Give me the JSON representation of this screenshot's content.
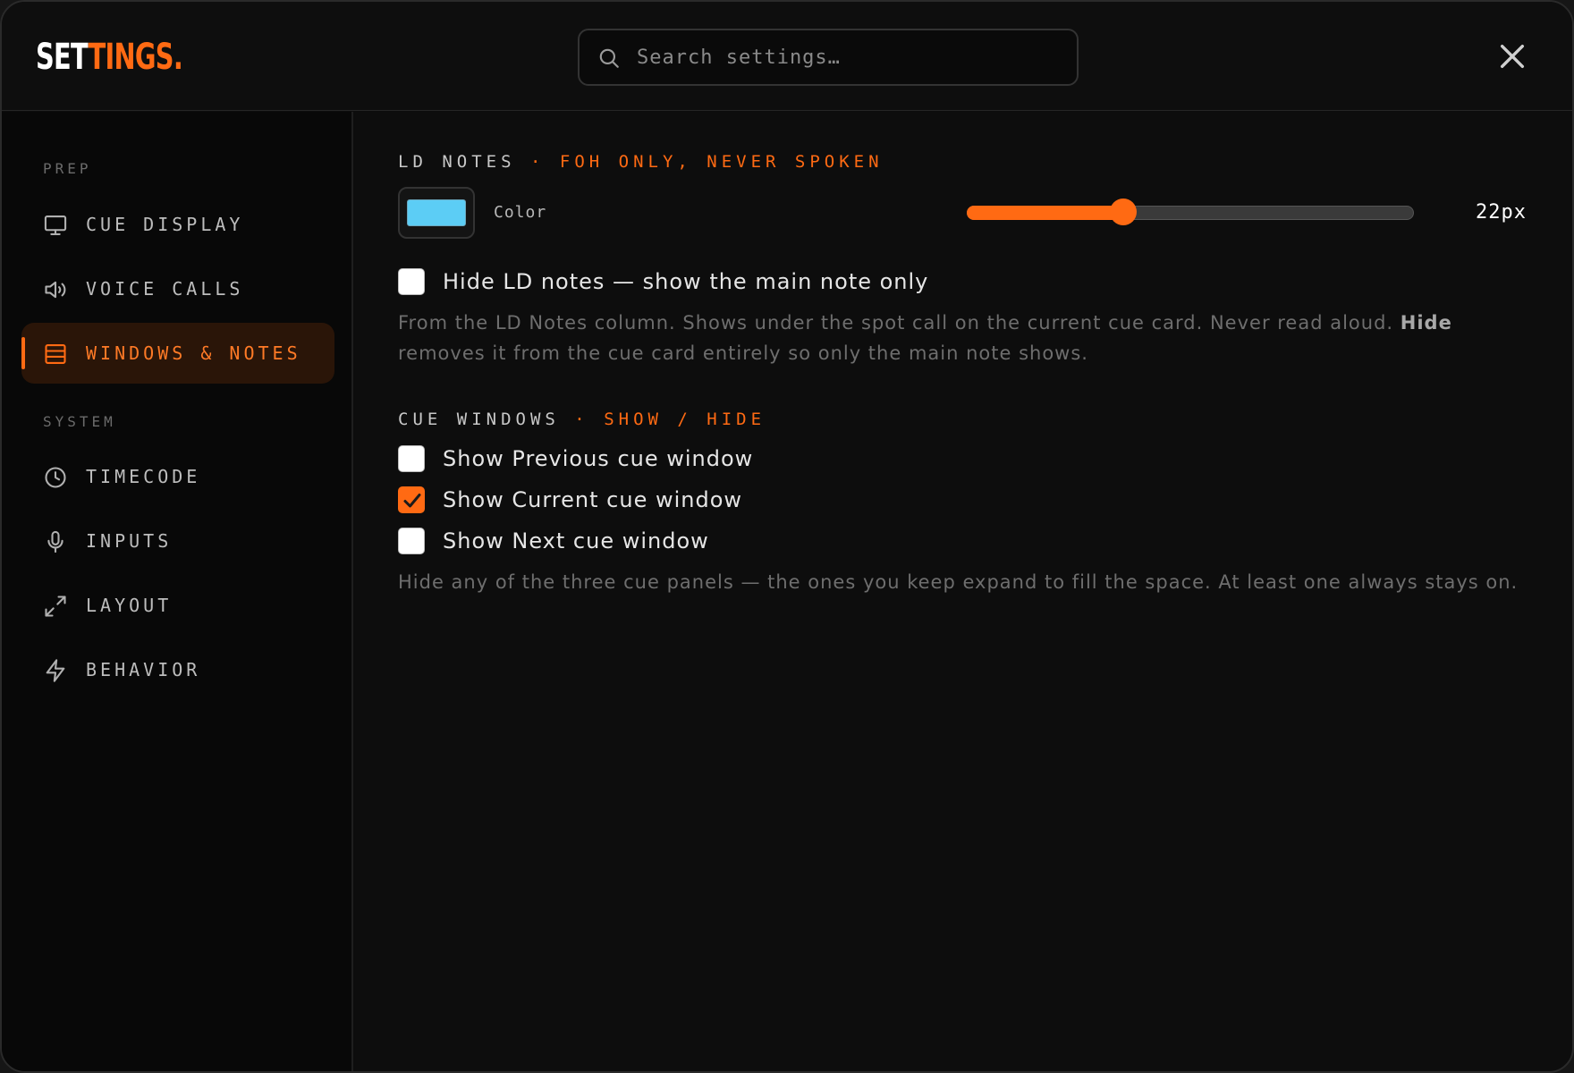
{
  "app": {
    "logo_part1": "SET",
    "logo_part2": "TINGS."
  },
  "colors": {
    "accent": "#ff6a13",
    "active_bg": "#2a1508",
    "ld_note_color": "#5ccdf5"
  },
  "search": {
    "placeholder": "Search settings…",
    "value": ""
  },
  "sidebar": {
    "sections": [
      {
        "label": "PREP",
        "items": [
          {
            "label": "CUE DISPLAY",
            "icon": "monitor-icon",
            "active": false
          },
          {
            "label": "VOICE CALLS",
            "icon": "speaker-icon",
            "active": false
          },
          {
            "label": "WINDOWS & NOTES",
            "icon": "windows-icon",
            "active": true
          }
        ]
      },
      {
        "label": "SYSTEM",
        "items": [
          {
            "label": "TIMECODE",
            "icon": "clock-icon",
            "active": false
          },
          {
            "label": "INPUTS",
            "icon": "microphone-icon",
            "active": false
          },
          {
            "label": "LAYOUT",
            "icon": "expand-icon",
            "active": false
          },
          {
            "label": "BEHAVIOR",
            "icon": "lightning-icon",
            "active": false
          }
        ]
      }
    ]
  },
  "ld_notes": {
    "heading": "LD NOTES",
    "separator": "·",
    "heading_accent": "FOH ONLY, NEVER SPOKEN",
    "color_label": "Color",
    "size_value": 22,
    "size_min": 8,
    "size_max": 48,
    "size_label": "22px",
    "hide_label": "Hide LD notes — show the main note only",
    "hide_checked": false,
    "desc_part1": "From the LD Notes column. Shows under the spot call on the current cue card. Never read aloud.",
    "desc_bold": "Hide",
    "desc_part2": "removes it from the cue card entirely so only the main note shows."
  },
  "cue_windows": {
    "heading": "CUE WINDOWS",
    "separator": "·",
    "heading_accent": "SHOW / HIDE",
    "options": [
      {
        "label": "Show Previous cue window",
        "checked": false
      },
      {
        "label": "Show Current cue window",
        "checked": true
      },
      {
        "label": "Show Next cue window",
        "checked": false
      }
    ],
    "description": "Hide any of the three cue panels — the ones you keep expand to fill the space. At least one always stays on."
  }
}
